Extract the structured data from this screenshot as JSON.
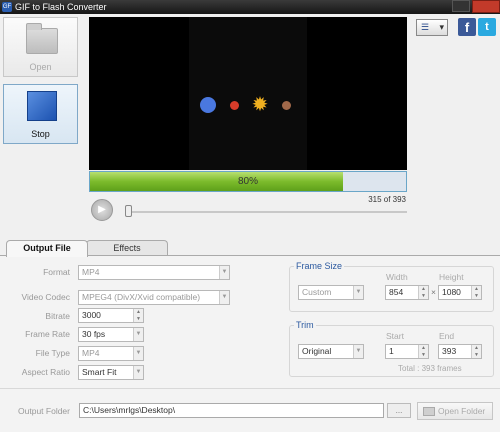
{
  "window": {
    "title": "GIF to Flash Converter",
    "icon_text": "GF"
  },
  "toolbar": {
    "open_label": "Open",
    "stop_label": "Stop",
    "list_icon": "list-icon",
    "menu_arrow": "▾"
  },
  "social": {
    "facebook": "f",
    "twitter": "t"
  },
  "preview": {
    "progress_percent": 80,
    "progress_text": "80%",
    "frame_counter": "315 of 393",
    "play_glyph": "▶",
    "sun_glyph": "✹"
  },
  "tabs": {
    "output": "Output File",
    "effects": "Effects"
  },
  "output_settings": {
    "format": {
      "label": "Format",
      "value": "MP4"
    },
    "video_codec": {
      "label": "Video Codec",
      "value": "MPEG4 (DivX/Xvid compatible)"
    },
    "bitrate": {
      "label": "Bitrate",
      "value": "3000"
    },
    "frame_rate": {
      "label": "Frame Rate",
      "value": "30 fps"
    },
    "file_type": {
      "label": "File Type",
      "value": "MP4"
    },
    "aspect_ratio": {
      "label": "Aspect Ratio",
      "value": "Smart Fit"
    }
  },
  "frame_size": {
    "title": "Frame Size",
    "mode": "Custom",
    "width_label": "Width",
    "height_label": "Height",
    "width": "854",
    "height": "1080",
    "times": "×"
  },
  "trim": {
    "title": "Trim",
    "mode": "Original",
    "start_label": "Start",
    "end_label": "End",
    "start": "1",
    "end": "393",
    "total": "Total : 393 frames"
  },
  "output_folder": {
    "label": "Output Folder",
    "path": "C:\\Users\\mrlgs\\Desktop\\",
    "browse": "...",
    "open_label": "Open Folder"
  },
  "colors": {
    "accent": "#2c5aa0",
    "progress_green": "#7cbb2c",
    "stop_blue": "#1c52b0",
    "facebook": "#3b5998",
    "twitter": "#2aa9e0"
  }
}
